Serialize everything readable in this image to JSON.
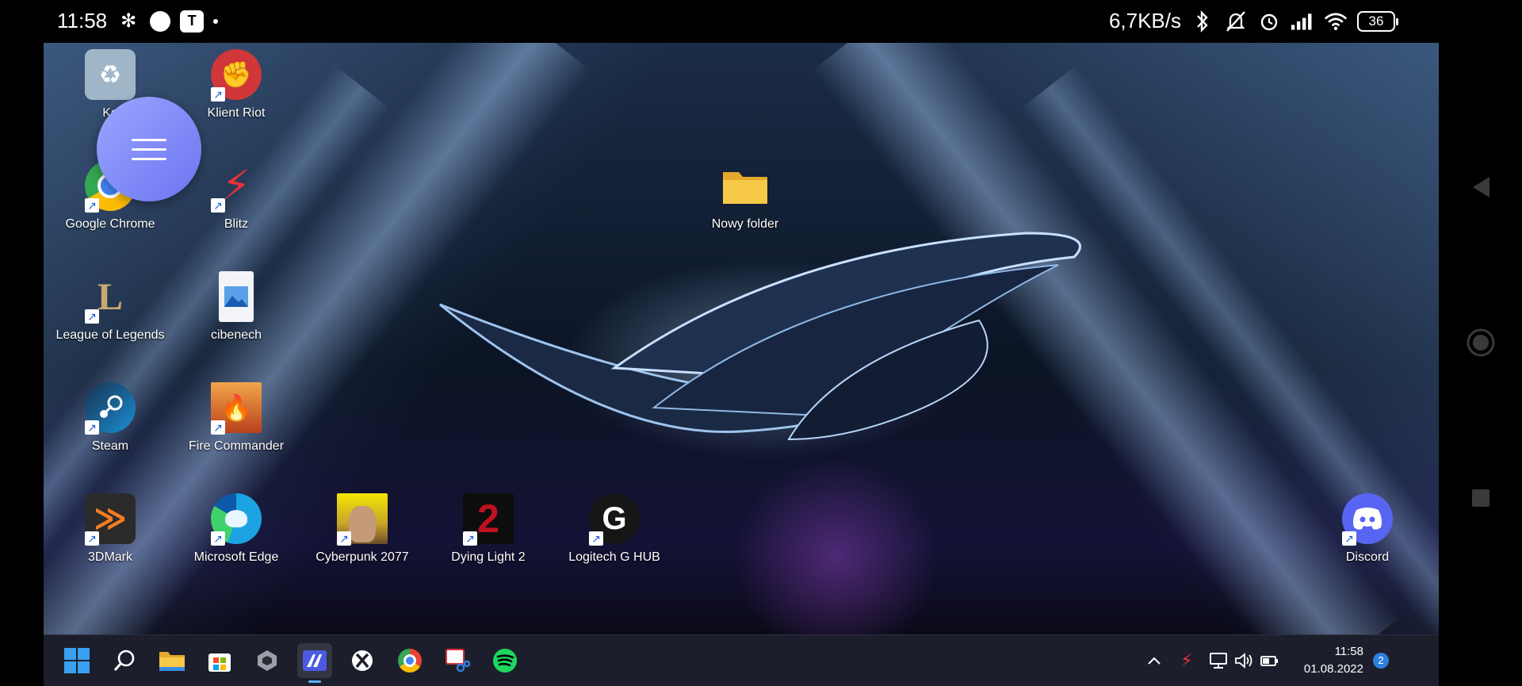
{
  "status_bar": {
    "time": "11:58",
    "net_speed": "6,7KB/s",
    "battery": "36"
  },
  "desktop": {
    "icons": [
      {
        "label": "Ko",
        "icon": "recycle-bin-icon",
        "color": "#9fb6c9"
      },
      {
        "label": "Klient Riot",
        "icon": "riot-client-icon",
        "color": "#d13639"
      },
      {
        "label": "Google Chrome",
        "icon": "chrome-icon",
        "color": "#4285f4"
      },
      {
        "label": "Blitz",
        "icon": "blitz-icon",
        "color": "#e8313a"
      },
      {
        "label": "Nowy folder",
        "icon": "folder-icon",
        "color": "#f5c242"
      },
      {
        "label": "League of Legends",
        "icon": "league-of-legends-icon",
        "color": "#c8aa6e"
      },
      {
        "label": "cibenech",
        "icon": "image-file-icon",
        "color": "#3a7bd5"
      },
      {
        "label": "Steam",
        "icon": "steam-icon",
        "color": "#1b2838"
      },
      {
        "label": "Fire Commander",
        "icon": "fire-commander-icon",
        "color": "#e07b2a"
      },
      {
        "label": "3DMark",
        "icon": "3dmark-icon",
        "color": "#f57c20"
      },
      {
        "label": "Microsoft Edge",
        "icon": "edge-icon",
        "color": "#1ba3e3"
      },
      {
        "label": "Cyberpunk 2077",
        "icon": "cyberpunk-icon",
        "color": "#f3e600"
      },
      {
        "label": "Dying Light 2",
        "icon": "dying-light-icon",
        "color": "#c0111f"
      },
      {
        "label": "Logitech G HUB",
        "icon": "logitech-g-hub-icon",
        "color": "#222222"
      },
      {
        "label": "Discord",
        "icon": "discord-icon",
        "color": "#5865f2"
      }
    ]
  },
  "taskbar": {
    "apps": [
      {
        "name": "start",
        "icon": "windows-start-icon"
      },
      {
        "name": "search",
        "icon": "search-icon"
      },
      {
        "name": "file-explorer",
        "icon": "folder-icon"
      },
      {
        "name": "microsoft-store",
        "icon": "store-icon"
      },
      {
        "name": "armoury-crate",
        "icon": "armoury-crate-icon"
      },
      {
        "name": "remote-app",
        "icon": "remote-desktop-icon",
        "active": true
      },
      {
        "name": "xbox",
        "icon": "xbox-icon"
      },
      {
        "name": "chrome",
        "icon": "chrome-icon"
      },
      {
        "name": "snipping-tool",
        "icon": "snipping-tool-icon"
      },
      {
        "name": "spotify",
        "icon": "spotify-icon"
      }
    ],
    "clock_time": "11:58",
    "clock_date": "01.08.2022",
    "notification_count": "2"
  }
}
